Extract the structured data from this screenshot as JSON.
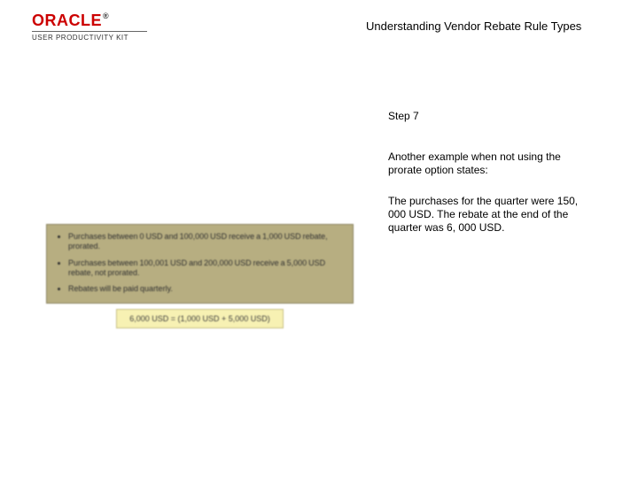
{
  "logo": {
    "brand": "ORACLE",
    "reg": "®",
    "sub": "USER PRODUCTIVITY KIT"
  },
  "title": "Understanding Vendor Rebate Rule Types",
  "step": "Step 7",
  "para1": "Another example when not using the prorate option states:",
  "para2": "The purchases for the quarter were 150, 000 USD. The rebate at the end of the quarter was 6, 000 USD.",
  "panel": {
    "items": [
      "Purchases between 0 USD and 100,000 USD receive a 1,000 USD rebate, prorated.",
      "Purchases between 100,001 USD and 200,000 USD receive a 5,000 USD rebate, not prorated.",
      "Rebates will be paid quarterly."
    ],
    "formula": "6,000 USD = (1,000 USD + 5,000 USD)"
  }
}
